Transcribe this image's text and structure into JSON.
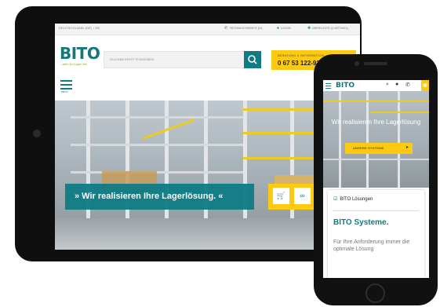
{
  "tablet": {
    "topbar": {
      "left_text": "DEUTSCHLAND (DE) / DE",
      "items": [
        {
          "icon": "phone-icon",
          "label": "TECHNISCHEINFO (H)"
        },
        {
          "icon": "user-icon",
          "label": "LOGIN"
        },
        {
          "icon": "bookmark-icon",
          "label": "MERKLISTE (0 ARTIKEL)"
        }
      ]
    },
    "logo": {
      "text": "BITO",
      "tagline": "...alles im Lager frei"
    },
    "search": {
      "placeholder": "SUCHBEGRIFF EINGEBEN"
    },
    "contact": {
      "label": "BERATUNG & INFORMATION",
      "phone": "0 67 53 122-922"
    },
    "menu": {
      "label": "MENÜ"
    },
    "hero": {
      "banner_text": "» Wir realisieren Ihre Lagerlösung. «",
      "tools": [
        "cart-icon",
        "link-icon",
        "mail-icon"
      ]
    },
    "colors": {
      "brand_teal": "#0f7c84",
      "brand_yellow": "#fdca11",
      "device": "#0f0f10"
    }
  },
  "phone": {
    "header": {
      "logo": "BITO",
      "icons": [
        "search-icon",
        "location-icon",
        "phone-icon",
        "cart-icon"
      ]
    },
    "hero": {
      "text": "Wir realisieren Ihre Lagerlösung",
      "button": "UNSERE SYSTEME"
    },
    "card": {
      "category": "BITO Lösungen",
      "title": "BITO Systeme.",
      "body": "Für Ihre Anforderung immer die optimale Lösung"
    }
  }
}
